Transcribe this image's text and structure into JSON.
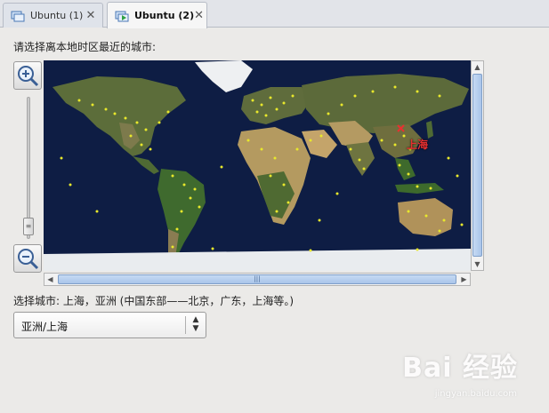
{
  "tabs": [
    {
      "label": "Ubuntu (1)",
      "close": "✕"
    },
    {
      "label": "Ubuntu (2)",
      "close": "✕"
    }
  ],
  "prompt": "请选择离本地时区最近的城市:",
  "map": {
    "selected_city_label": "上海",
    "colors": {
      "ocean": "#0e1d44",
      "land": "#5a6b3a",
      "desert": "#b59a62",
      "ice": "#f2f2f2",
      "city_dot": "#e8e82c",
      "marker": "#e83030"
    }
  },
  "zoom": {
    "in_icon": "zoom-in-icon",
    "out_icon": "zoom-out-icon"
  },
  "selected_city_text": "选择城市: 上海，亚洲 (中国东部——北京，广东，上海等。)",
  "timezone_select": {
    "value": "亚洲/上海"
  },
  "watermark": {
    "text": "Bai 经验",
    "sub": "jingyan.baidu.com"
  }
}
